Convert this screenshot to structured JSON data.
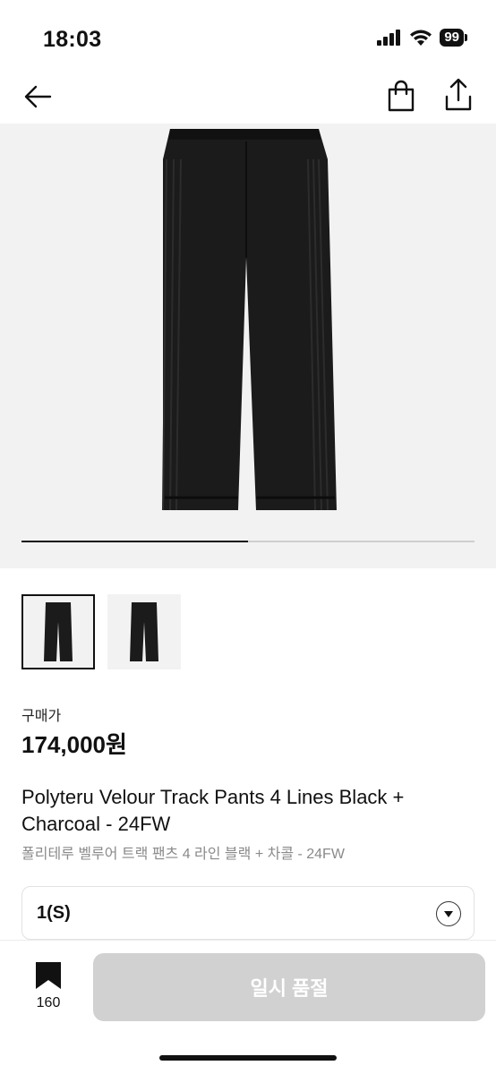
{
  "status_bar": {
    "time": "18:03",
    "battery": "99"
  },
  "product": {
    "price_label": "구매가",
    "price": "174,000원",
    "title": "Polyteru Velour Track Pants 4 Lines Black + Charcoal - 24FW",
    "subtitle": "폴리테루 벨루어 트랙 팬츠 4 라인 블랙 + 차콜 - 24FW",
    "image_progress": 0.5
  },
  "size_select": {
    "value": "1(S)"
  },
  "bottom_bar": {
    "bookmark_count": "160",
    "action_label": "일시 품절"
  },
  "icons": {
    "back": "arrow-left-icon",
    "bag": "shopping-bag-icon",
    "share": "share-icon",
    "bookmark": "bookmark-icon",
    "dropdown": "chevron-down-icon"
  }
}
